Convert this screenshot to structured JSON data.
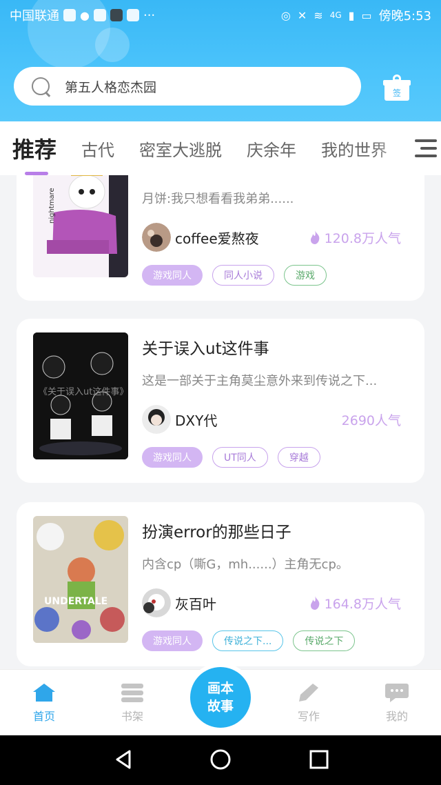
{
  "status_bar": {
    "carrier": "中国联通",
    "more": "···",
    "network": "4G",
    "time": "傍晚5:53"
  },
  "search": {
    "placeholder": "第五人格恋杰园"
  },
  "gift": {
    "label": "签"
  },
  "tabs": [
    {
      "label": "推荐",
      "active": true
    },
    {
      "label": "古代"
    },
    {
      "label": "密室大逃脱"
    },
    {
      "label": "庆余年"
    },
    {
      "label": "我的世界"
    }
  ],
  "stories": [
    {
      "title": "",
      "description": "月饼:我只想看看我弟弟......",
      "author": "coffee爱熬夜",
      "popularity": "120.8万人气",
      "show_flame": true,
      "cover_text": "nightmare",
      "tags": [
        {
          "label": "游戏同人",
          "style": "solid"
        },
        {
          "label": "同人小说",
          "style": "purple"
        },
        {
          "label": "游戏",
          "style": "green"
        }
      ]
    },
    {
      "title": "关于误入ut这件事",
      "description": "这是一部关于主角莫尘意外来到传说之下...",
      "author": "DXY代",
      "popularity": "2690人气",
      "show_flame": false,
      "cover_text": "《关于误入ut这件事》",
      "tags": [
        {
          "label": "游戏同人",
          "style": "solid"
        },
        {
          "label": "UT同人",
          "style": "purple"
        },
        {
          "label": "穿越",
          "style": "purple"
        }
      ]
    },
    {
      "title": "扮演error的那些日子",
      "description": "内含cp（嘶G，mh......）主角无cp。",
      "author": "灰百叶",
      "popularity": "164.8万人气",
      "show_flame": true,
      "cover_text": "UNDERTALE",
      "tags": [
        {
          "label": "游戏同人",
          "style": "solid"
        },
        {
          "label": "传说之下...",
          "style": "blue"
        },
        {
          "label": "传说之下",
          "style": "green"
        }
      ]
    }
  ],
  "bottom_nav": {
    "home": "首页",
    "shelf": "书架",
    "center_line1": "画本",
    "center_line2": "故事",
    "write": "写作",
    "mine": "我的"
  },
  "colors": {
    "header_blue": "#39b8f6",
    "accent_purple": "#b87ee8",
    "nav_active": "#2fa6ea"
  }
}
